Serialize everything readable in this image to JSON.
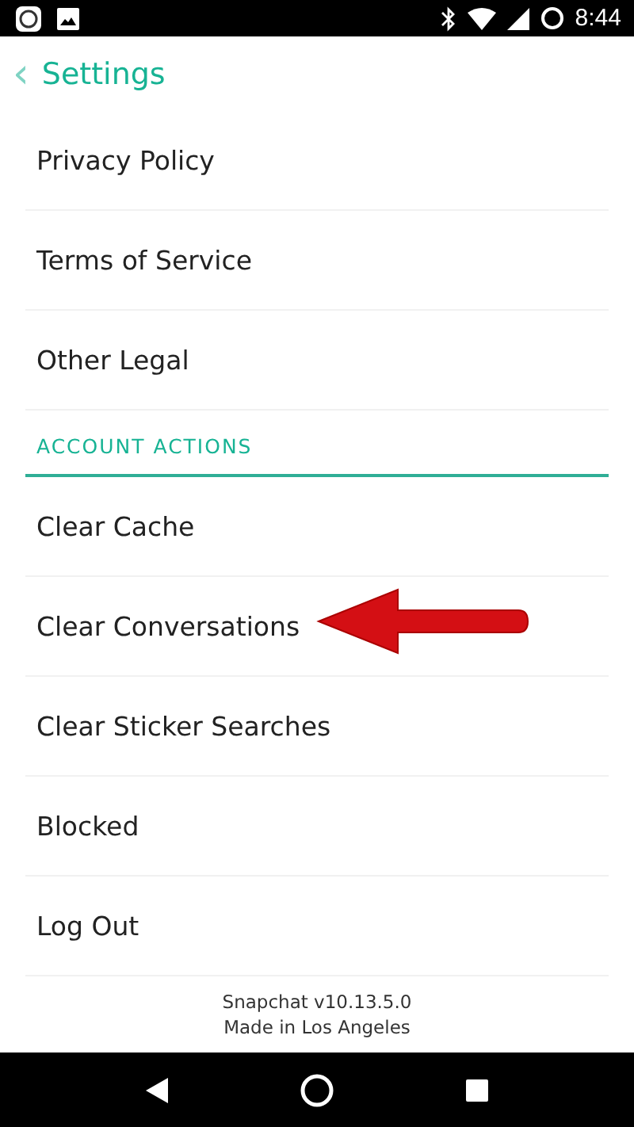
{
  "status_bar": {
    "time": "8:44"
  },
  "header": {
    "back": "‹",
    "title": "Settings"
  },
  "groups": [
    {
      "items": [
        {
          "label": "Privacy Policy",
          "pointed": false
        },
        {
          "label": "Terms of Service",
          "pointed": false
        },
        {
          "label": "Other Legal",
          "pointed": false
        }
      ]
    },
    {
      "heading": "ACCOUNT ACTIONS",
      "items": [
        {
          "label": "Clear Cache",
          "pointed": false
        },
        {
          "label": "Clear Conversations",
          "pointed": true
        },
        {
          "label": "Clear Sticker Searches",
          "pointed": false
        },
        {
          "label": "Blocked",
          "pointed": false
        },
        {
          "label": "Log Out",
          "pointed": false
        }
      ]
    }
  ],
  "footer": [
    "Snapchat v10.13.5.0",
    "Made in Los Angeles"
  ]
}
